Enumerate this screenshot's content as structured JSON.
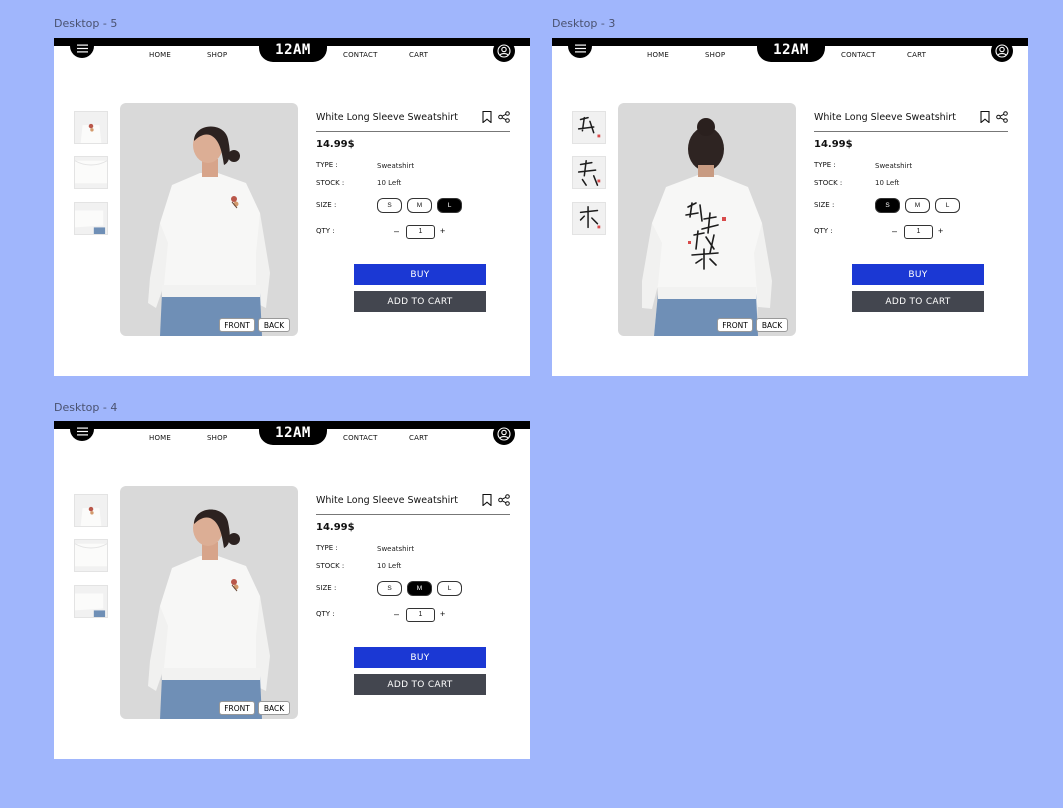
{
  "frames": [
    {
      "label": "Desktop - 5",
      "selected_size": "L",
      "view": "front"
    },
    {
      "label": "Desktop - 3",
      "selected_size": "S",
      "view": "back"
    },
    {
      "label": "Desktop - 4",
      "selected_size": "M",
      "view": "front"
    }
  ],
  "nav": {
    "home": "HOME",
    "shop": "SHOP",
    "logo": "12AM",
    "contact": "CONTACT",
    "cart": "CART"
  },
  "product": {
    "title": "White Long Sleeve Sweatshirt",
    "price": "14.99$",
    "type_label": "TYPE :",
    "type_value": "Sweatshirt",
    "stock_label": "STOCK :",
    "stock_value": "10 Left",
    "size_label": "SIZE :",
    "sizes": [
      "S",
      "M",
      "L"
    ],
    "qty_label": "QTY :",
    "qty_minus": "–",
    "qty_value": "1",
    "qty_plus": "+"
  },
  "buttons": {
    "buy": "BUY",
    "add_to_cart": "ADD TO CART",
    "front": "FRONT",
    "back": "BACK"
  },
  "colors": {
    "background": "#a0b6fc",
    "buy": "#1b38d4",
    "add_to_cart": "#43464f",
    "nav_black": "#000000"
  },
  "icons": [
    "menu-icon",
    "user-icon",
    "bookmark-icon",
    "share-icon"
  ]
}
